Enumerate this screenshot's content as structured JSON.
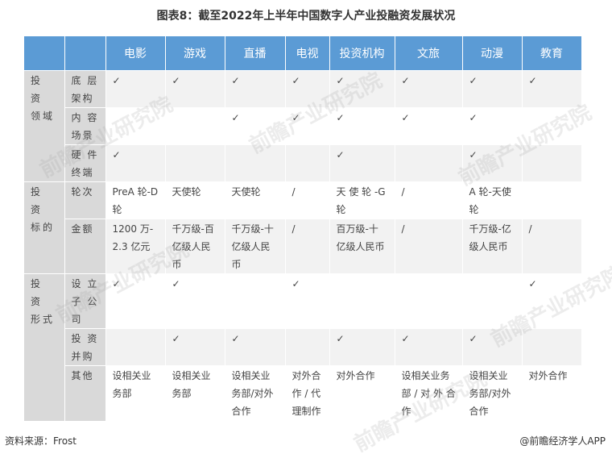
{
  "title": "图表8：截至2022年上半年中国数字人产业投融资发展状况",
  "columns": [
    "电影",
    "游戏",
    "直播",
    "电视",
    "投资机构",
    "文旅",
    "动漫",
    "教育"
  ],
  "groups": [
    {
      "label": "投 资 领域",
      "rows": [
        {
          "label": "底 层 架构",
          "cells": [
            "✓",
            "✓",
            "✓",
            "✓",
            "✓",
            "✓",
            "✓",
            "✓"
          ]
        },
        {
          "label": "内 容 场景",
          "cells": [
            "",
            "",
            "✓",
            "✓",
            "✓",
            "✓",
            "✓",
            ""
          ]
        },
        {
          "label": "硬 件 终端",
          "cells": [
            "✓",
            "",
            "",
            "",
            "✓",
            "",
            "✓",
            ""
          ]
        }
      ]
    },
    {
      "label": "投 资 标的",
      "rows": [
        {
          "label": "轮次",
          "cells": [
            "PreA 轮-D 轮",
            "天使轮",
            "天使轮",
            "/",
            "天 使 轮 -G 轮",
            "/",
            "A 轮-天使 轮",
            ""
          ]
        },
        {
          "label": "金额",
          "cells": [
            "1200 万- 2.3 亿元",
            "千万级-百 亿级人民 币",
            "千万级-十 亿级人民 币",
            "/",
            "百万级-十 亿级人民币",
            "/",
            "千万级-亿 级人民币",
            "/"
          ]
        }
      ]
    },
    {
      "label": "投 资 形式",
      "rows": [
        {
          "label": "设 立 子 公 司",
          "cells": [
            "✓",
            "✓",
            "",
            "✓",
            "",
            "",
            "",
            "✓"
          ]
        },
        {
          "label": "投 资 并购",
          "cells": [
            "",
            "✓",
            "✓",
            "",
            "✓",
            "✓",
            "✓",
            ""
          ]
        },
        {
          "label": "其他",
          "cells": [
            "设相关业 务部",
            "设相关业 务部",
            "设相关业 务部/对外 合作",
            "对外合 作 / 代 理制作",
            "对外合作",
            "设相关业务 部 / 对 外 合 作",
            "设相关业 务部/对外 合作",
            "对外合作"
          ]
        }
      ]
    }
  ],
  "footer": {
    "source": "资料来源：Frost",
    "credit": "@前瞻经济学人APP"
  },
  "watermark": "前瞻产业研究院"
}
